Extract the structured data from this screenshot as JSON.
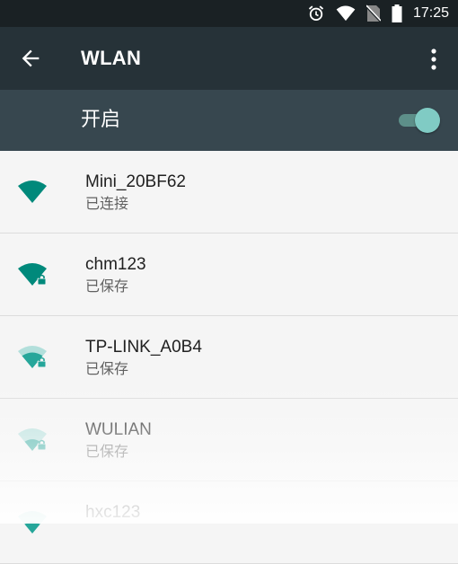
{
  "status_bar": {
    "time": "17:25",
    "icons": [
      "alarm-icon",
      "wifi-signal-icon",
      "no-sim-icon",
      "battery-icon"
    ]
  },
  "app_bar": {
    "title": "WLAN",
    "back_icon": "arrow-back-icon",
    "menu_icon": "more-vert-icon"
  },
  "wifi_toggle": {
    "label": "开启",
    "state": "on"
  },
  "networks": [
    {
      "name": "Mini_20BF62",
      "status": "已连接",
      "secured": false,
      "signal": "full"
    },
    {
      "name": "chm123",
      "status": "已保存",
      "secured": true,
      "signal": "full"
    },
    {
      "name": "TP-LINK_A0B4",
      "status": "已保存",
      "secured": true,
      "signal": "medium"
    },
    {
      "name": "WULIAN",
      "status": "已保存",
      "secured": true,
      "signal": "low"
    },
    {
      "name": "hxc123",
      "status": "",
      "secured": false,
      "signal": "low"
    }
  ],
  "colors": {
    "status_bar": "#1a2124",
    "app_bar": "#263238",
    "switch_bar": "#37474f",
    "accent": "#00897b",
    "toggle_thumb": "#80cbc4"
  }
}
